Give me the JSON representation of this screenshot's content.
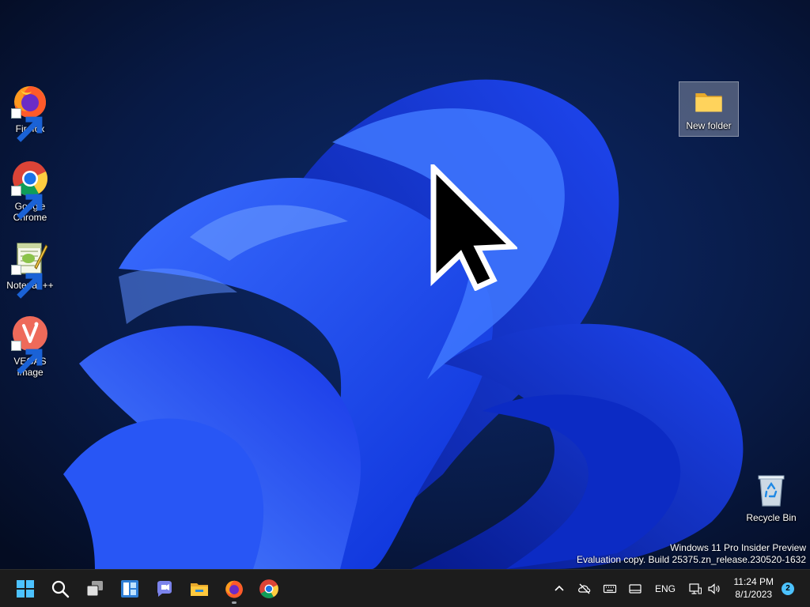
{
  "desktop": {
    "icons": [
      {
        "label": "Firefox"
      },
      {
        "label": "Google Chrome"
      },
      {
        "label": "Notepad++"
      },
      {
        "label": "VEGAS Image"
      },
      {
        "label": "New folder"
      },
      {
        "label": "Recycle Bin"
      }
    ],
    "watermark": {
      "line1": "Windows 11 Pro Insider Preview",
      "line2": "Evaluation copy. Build 25375.zn_release.230520-1632"
    }
  },
  "taskbar": {
    "pinned": [
      {
        "icon": "windows-start-icon"
      },
      {
        "icon": "search-icon"
      },
      {
        "icon": "task-view-icon"
      },
      {
        "icon": "widgets-icon"
      },
      {
        "icon": "teams-chat-icon"
      },
      {
        "icon": "file-explorer-icon"
      },
      {
        "icon": "firefox-icon"
      },
      {
        "icon": "chrome-icon"
      }
    ],
    "tray": {
      "language": "ENG",
      "time": "11:24 PM",
      "date": "8/1/2023",
      "notification_count": "2"
    }
  },
  "colors": {
    "accent": "#1f4fff",
    "taskbar": "#1c1c1c",
    "notification": "#4cc2ff"
  }
}
